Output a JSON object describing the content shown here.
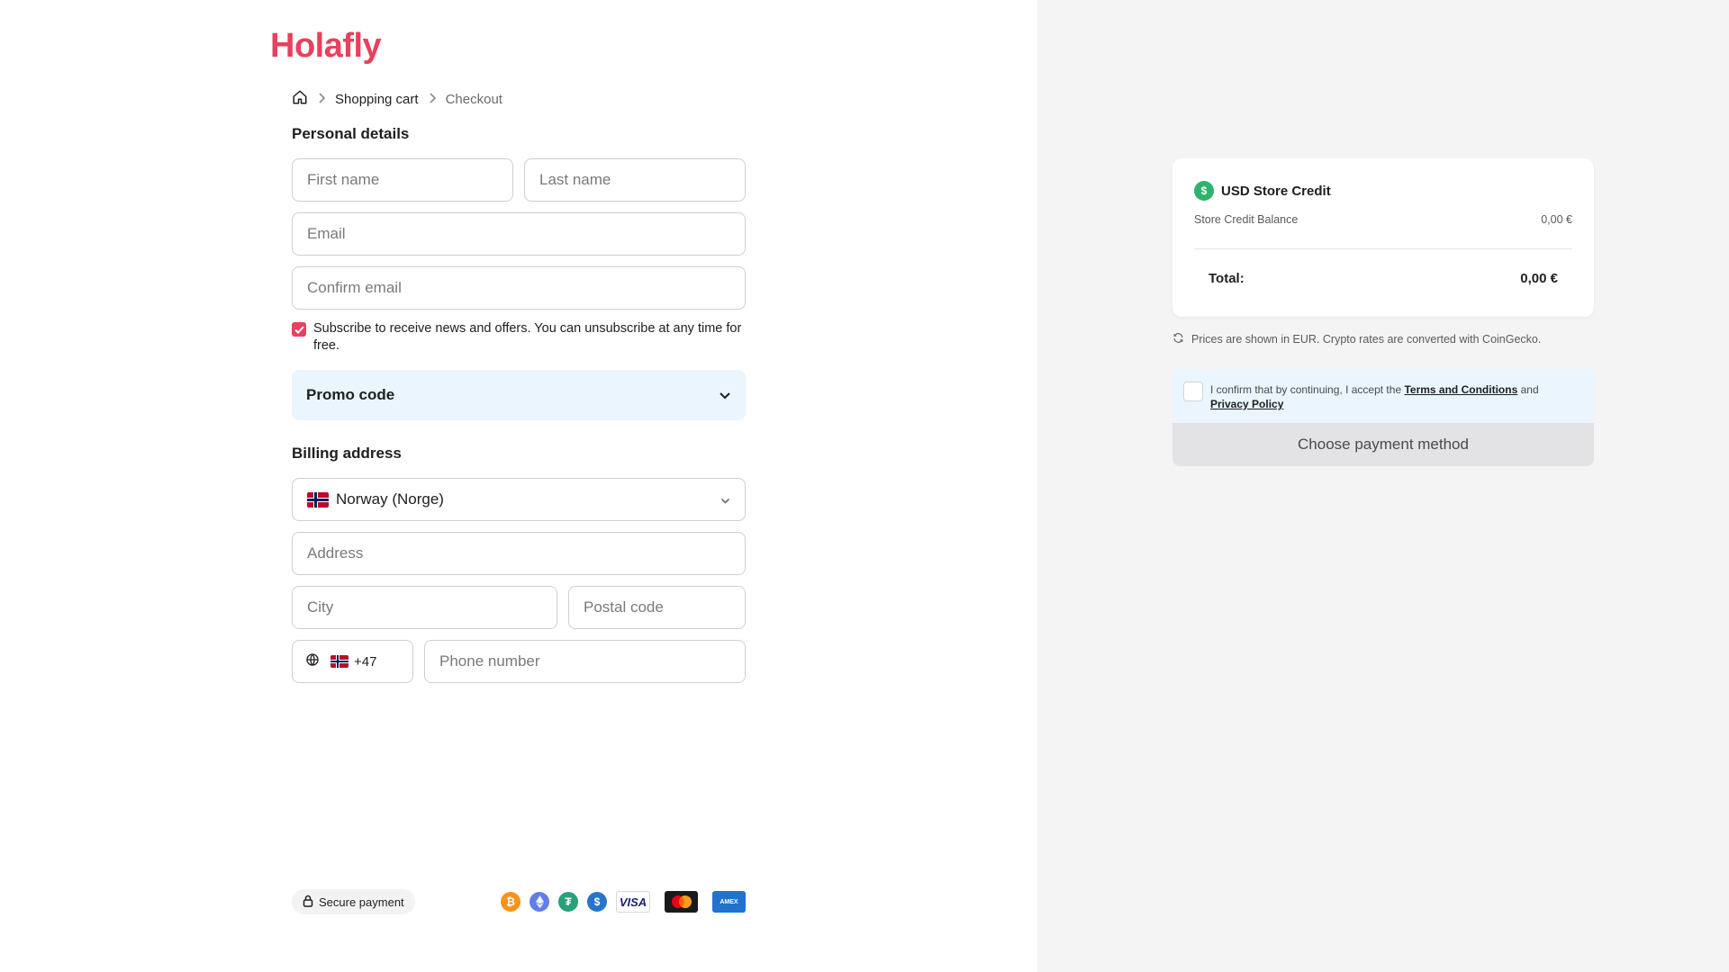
{
  "brand": {
    "logo_text": "Holafly",
    "color": "#e8405e"
  },
  "breadcrumb": {
    "home_icon": "home-icon",
    "items": [
      "Shopping cart",
      "Checkout"
    ]
  },
  "personal": {
    "title": "Personal details",
    "first_name_placeholder": "First name",
    "last_name_placeholder": "Last name",
    "email_placeholder": "Email",
    "confirm_email_placeholder": "Confirm email",
    "subscribe_text": "Subscribe to receive news and offers. You can unsubscribe at any time for free.",
    "subscribe_checked": true
  },
  "promo": {
    "label": "Promo code"
  },
  "billing": {
    "title": "Billing address",
    "country": "Norway (Norge)",
    "address_placeholder": "Address",
    "city_placeholder": "City",
    "postal_placeholder": "Postal code",
    "phone_prefix": "+47",
    "phone_placeholder": "Phone number"
  },
  "footer": {
    "secure_label": "Secure payment",
    "payment_icons": [
      "bitcoin-icon",
      "ethereum-icon",
      "tether-icon",
      "usdc-icon",
      "visa-icon",
      "mastercard-icon",
      "amex-icon"
    ],
    "amex_text": "AMEX",
    "visa_text": "VISA"
  },
  "summary": {
    "credit_title": "USD Store Credit",
    "balance_label": "Store Credit Balance",
    "balance_value": "0,00 €",
    "total_label": "Total:",
    "total_value": "0,00 €",
    "prices_note": "Prices are shown in EUR. Crypto rates are converted with CoinGecko.",
    "confirm_prefix": "I confirm that by continuing, I accept the",
    "terms_link": "Terms and Conditions",
    "confirm_and": "and",
    "privacy_link": "Privacy Policy",
    "choose_button": "Choose payment method"
  },
  "colors": {
    "accent": "#e8405e",
    "promo_bg": "#eaf5fd",
    "right_bg": "#f4f4f4",
    "credit_green": "#2fb36d"
  }
}
